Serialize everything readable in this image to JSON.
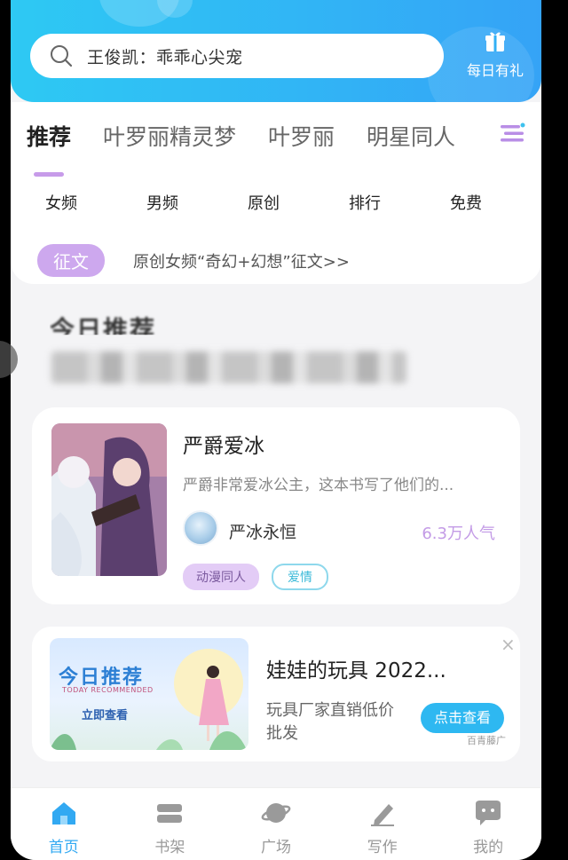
{
  "search": {
    "placeholder_text": "王俊凯：乖乖心尖宠"
  },
  "gift": {
    "label": "每日有礼",
    "icon": "gift-icon"
  },
  "tabs": [
    "推荐",
    "叶罗丽精灵梦",
    "叶罗丽",
    "明星同人"
  ],
  "categories": [
    "女频",
    "男频",
    "原创",
    "排行",
    "免费"
  ],
  "notice": {
    "badge": "征文",
    "text": "原创女频“奇幻+幻想”征文>>"
  },
  "section": {
    "title": "今日推荐"
  },
  "book": {
    "title": "严爵爱冰",
    "desc": "严爵非常爱冰公主，这本书写了他们的...",
    "author": "严冰永恒",
    "popularity": "6.3万人气",
    "tags": [
      "动漫同人",
      "爱情"
    ]
  },
  "ad": {
    "image_big": "今日推荐",
    "image_small": "TODAY RECOMMENDED",
    "image_look": "立即查看",
    "title": "娃娃的玩具 2022...",
    "desc": "玩具厂家直销低价批发",
    "button": "点击查看",
    "source": "百青藤广",
    "close": "×"
  },
  "nav": [
    {
      "label": "首页",
      "icon": "home-icon",
      "active": true
    },
    {
      "label": "书架",
      "icon": "bookshelf-icon",
      "active": false
    },
    {
      "label": "广场",
      "icon": "planet-icon",
      "active": false
    },
    {
      "label": "写作",
      "icon": "pen-icon",
      "active": false
    },
    {
      "label": "我的",
      "icon": "chat-icon",
      "active": false
    }
  ],
  "colors": {
    "accent": "#32a9f2",
    "purple": "#c79be9",
    "header_start": "#2ec9f3",
    "header_end": "#35a3f6"
  }
}
